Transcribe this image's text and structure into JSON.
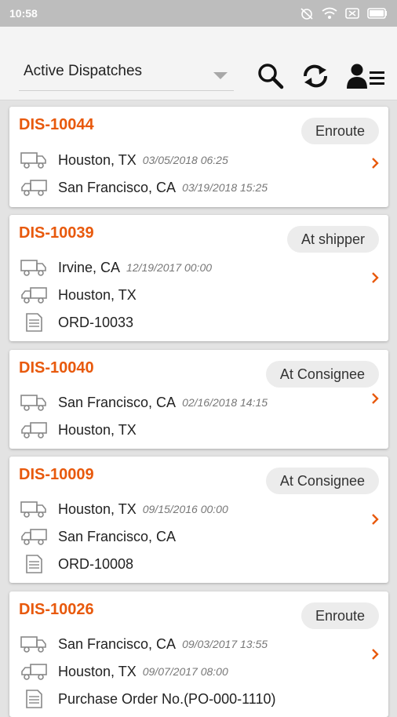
{
  "status_bar": {
    "time": "10:58"
  },
  "toolbar": {
    "filter_label": "Active Dispatches",
    "search_icon": "search-icon",
    "refresh_icon": "refresh-icon",
    "account_icon": "account-menu-icon"
  },
  "colors": {
    "accent": "#e8590c",
    "badge_bg": "#ececec"
  },
  "dispatches": [
    {
      "id": "DIS-10044",
      "status": "Enroute",
      "origin": "Houston, TX",
      "origin_time": "03/05/2018 06:25",
      "destination": "San Francisco, CA",
      "destination_time": "03/19/2018 15:25",
      "order": ""
    },
    {
      "id": "DIS-10039",
      "status": "At shipper",
      "origin": "Irvine, CA",
      "origin_time": "12/19/2017 00:00",
      "destination": "Houston, TX",
      "destination_time": "",
      "order": "ORD-10033"
    },
    {
      "id": "DIS-10040",
      "status": "At Consignee",
      "origin": "San Francisco, CA",
      "origin_time": "02/16/2018 14:15",
      "destination": "Houston, TX",
      "destination_time": "",
      "order": ""
    },
    {
      "id": "DIS-10009",
      "status": "At Consignee",
      "origin": "Houston, TX",
      "origin_time": "09/15/2016 00:00",
      "destination": "San Francisco, CA",
      "destination_time": "",
      "order": "ORD-10008"
    },
    {
      "id": "DIS-10026",
      "status": "Enroute",
      "origin": "San Francisco, CA",
      "origin_time": "09/03/2017 13:55",
      "destination": "Houston, TX",
      "destination_time": "09/07/2017 08:00",
      "order": "Purchase Order No.(PO-000-1110)"
    }
  ]
}
